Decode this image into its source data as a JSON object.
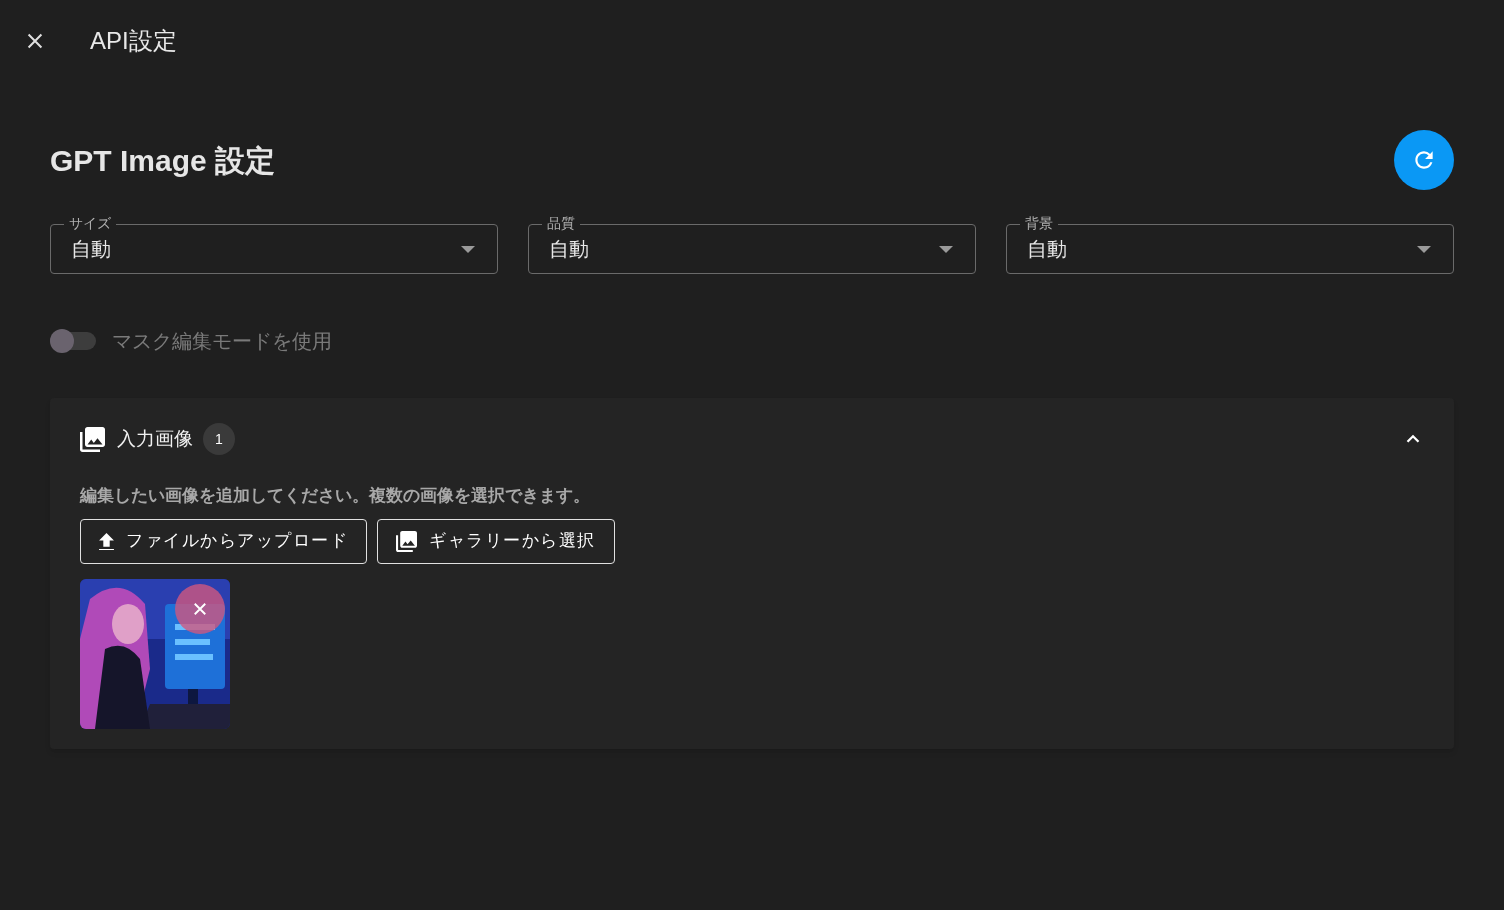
{
  "header": {
    "title": "API設定"
  },
  "section": {
    "title": "GPT Image 設定"
  },
  "selects": [
    {
      "label": "サイズ",
      "value": "自動"
    },
    {
      "label": "品質",
      "value": "自動"
    },
    {
      "label": "背景",
      "value": "自動"
    }
  ],
  "mask_toggle": {
    "label": "マスク編集モードを使用",
    "on": false,
    "disabled": true
  },
  "input_images": {
    "title": "入力画像",
    "count": "1",
    "expanded": true,
    "hint": "編集したい画像を追加してください。複数の画像を選択できます。",
    "buttons": [
      {
        "kind": "upload",
        "label": "ファイルからアップロード"
      },
      {
        "kind": "gallery",
        "label": "ギャラリーから選択"
      }
    ]
  }
}
